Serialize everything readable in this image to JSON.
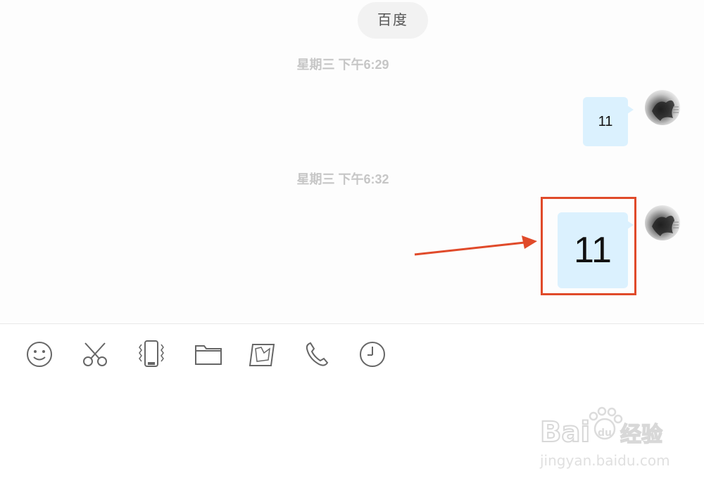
{
  "chat": {
    "title": "百度",
    "messages": [
      {
        "timestamp": "星期三   下午6:29",
        "text": "11"
      },
      {
        "timestamp": "星期三   下午6:32",
        "text": "11"
      }
    ]
  },
  "toolbar": {
    "icons": [
      "emoji-icon",
      "scissors-icon",
      "vibrate-phone-icon",
      "folder-icon",
      "image-icon",
      "phone-icon",
      "clock-icon"
    ]
  },
  "annotation": {
    "color": "#e04a2a"
  },
  "colors": {
    "bubble": "#dbf1fe",
    "timestamp": "#c6c6c6"
  }
}
